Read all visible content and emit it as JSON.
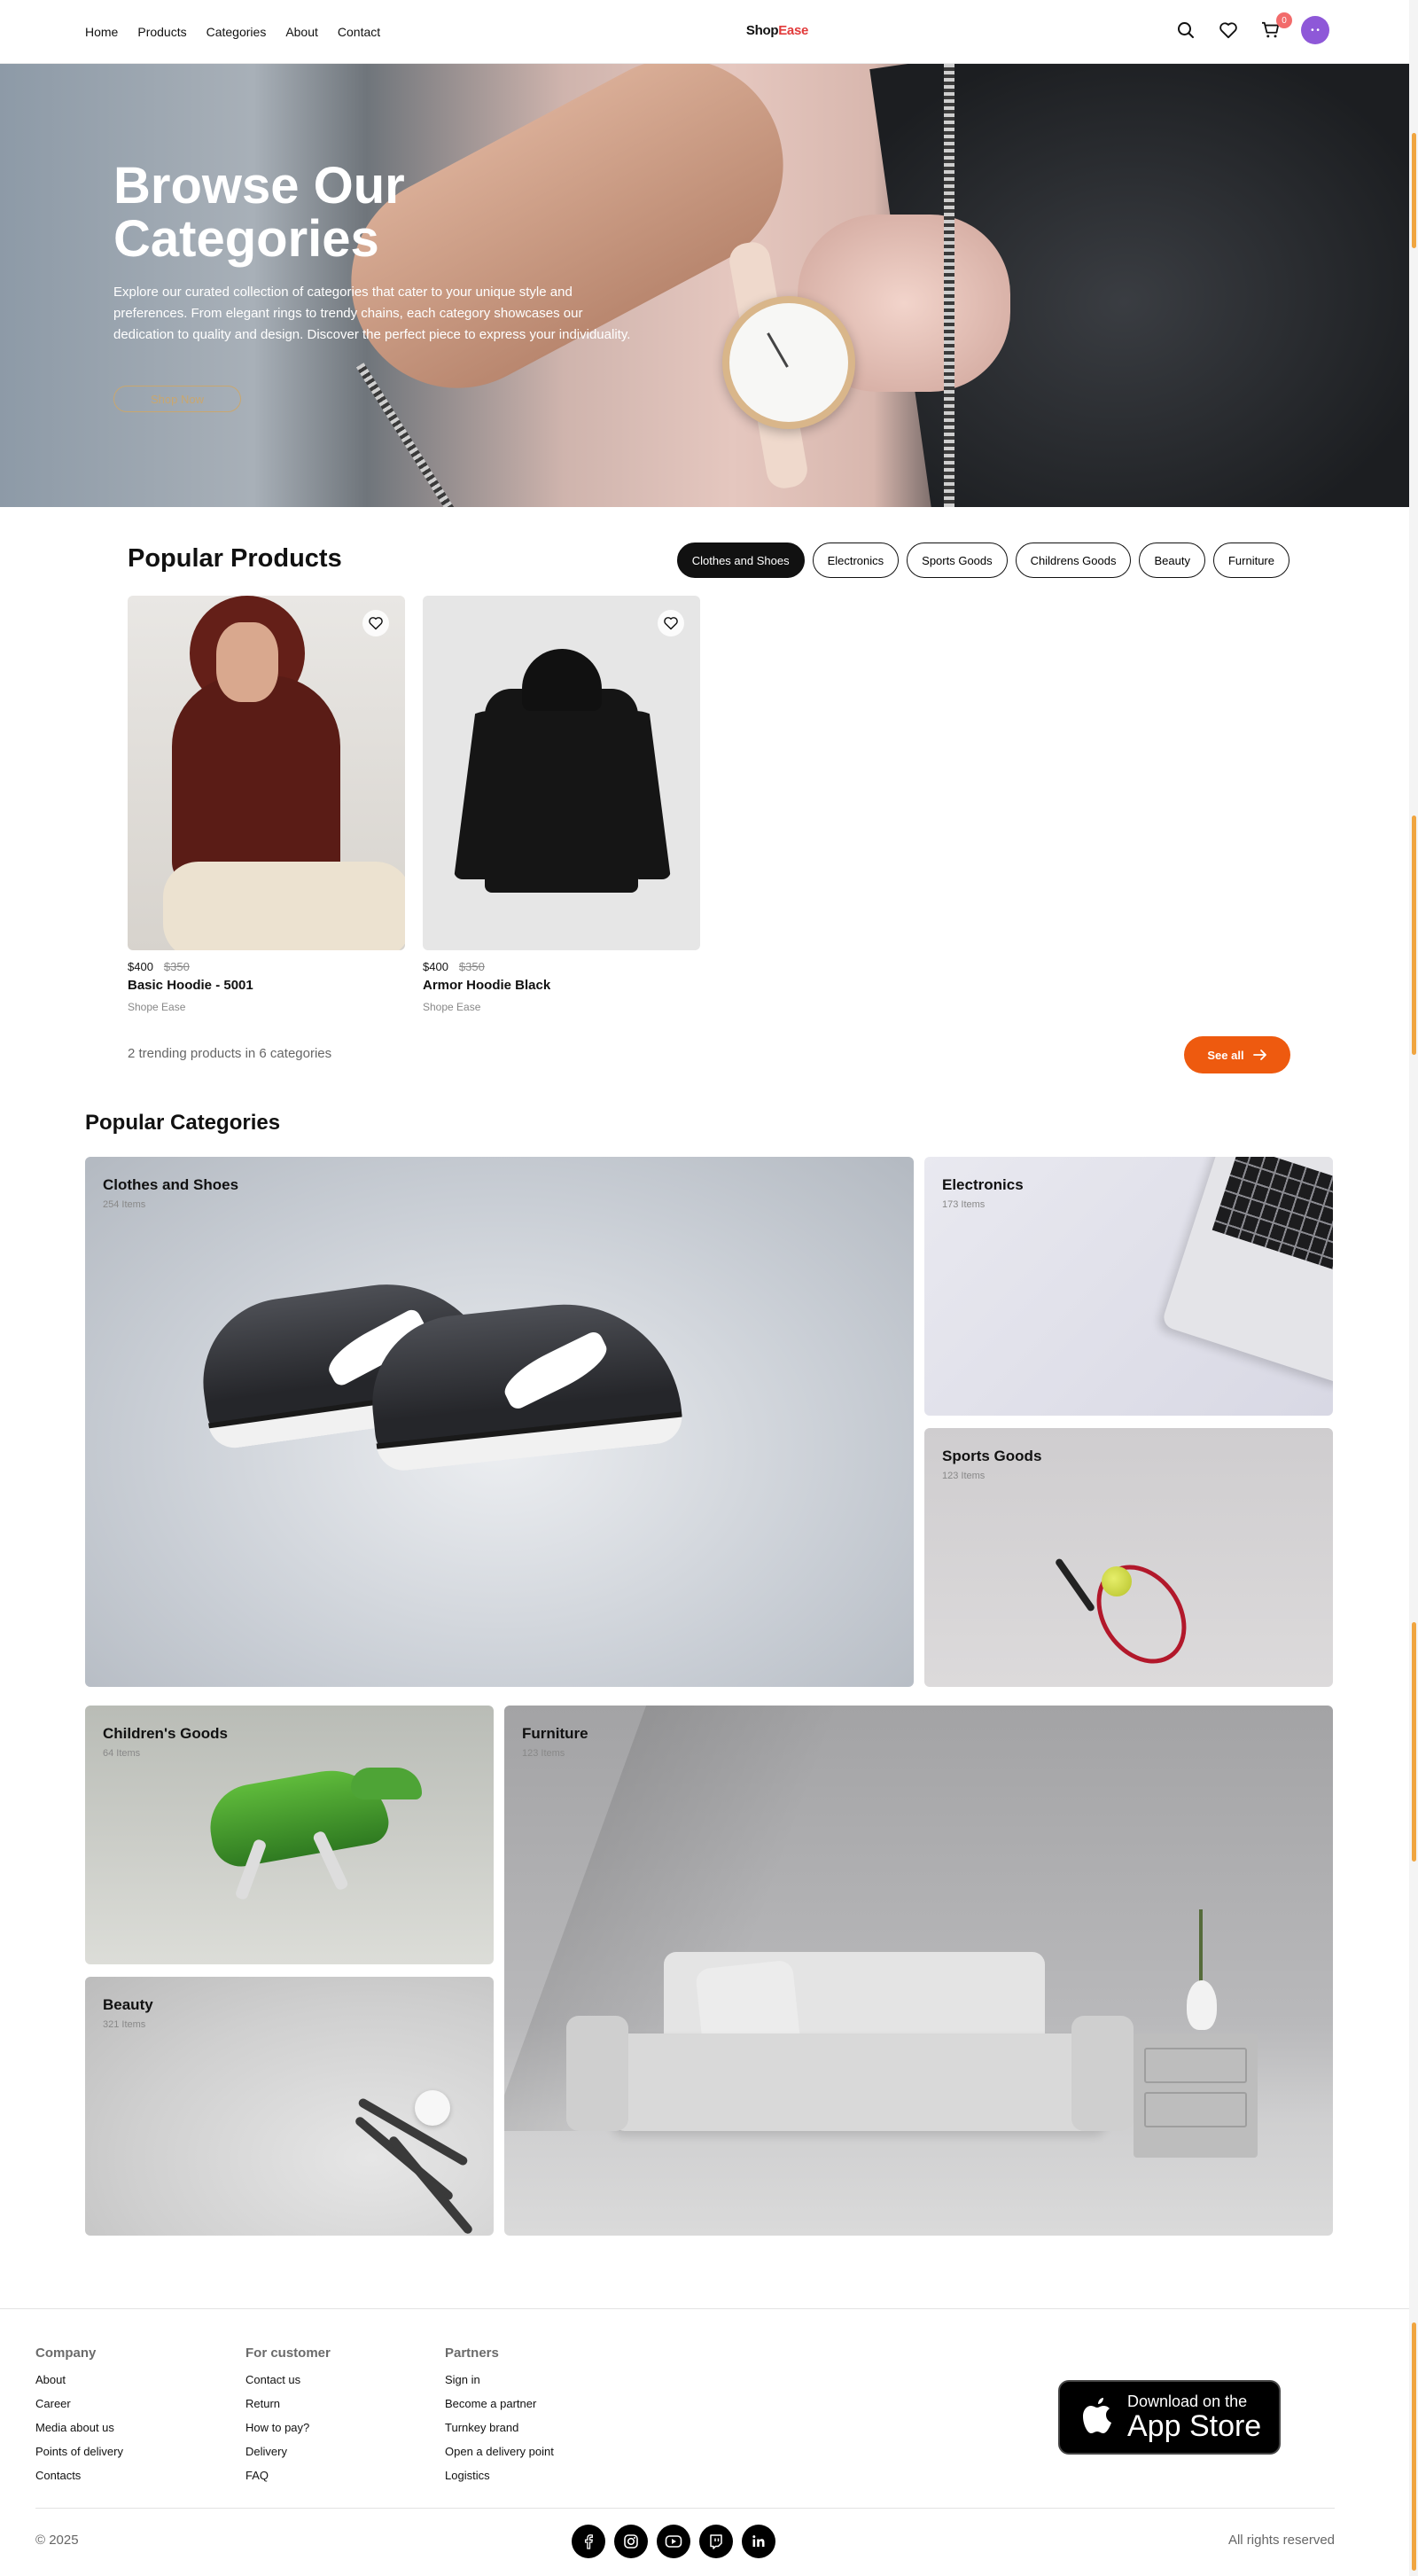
{
  "header": {
    "nav": [
      "Home",
      "Products",
      "Categories",
      "About",
      "Contact"
    ],
    "logo_part1": "Shop",
    "logo_part2": "Ease",
    "cart_count": "0",
    "avatar_text": "• •",
    "icons": [
      "search-icon",
      "heart-icon",
      "cart-icon",
      "avatar"
    ]
  },
  "hero": {
    "title": "Browse Our Categories",
    "description": "Explore our curated collection of categories that cater to your unique style and preferences. From elegant rings to trendy chains, each category showcases our dedication to quality and design. Discover the perfect piece to express your individuality.",
    "button": "Shop Now"
  },
  "popular_products": {
    "title": "Popular Products",
    "filters": [
      {
        "label": "Clothes and Shoes",
        "active": true
      },
      {
        "label": "Electronics",
        "active": false
      },
      {
        "label": "Sports Goods",
        "active": false
      },
      {
        "label": "Childrens Goods",
        "active": false
      },
      {
        "label": "Beauty",
        "active": false
      },
      {
        "label": "Furniture",
        "active": false
      }
    ],
    "products": [
      {
        "price": "$400",
        "old_price": "$350",
        "name": "Basic Hoodie - 5001",
        "brand": "Shope Ease"
      },
      {
        "price": "$400",
        "old_price": "$350",
        "name": "Armor Hoodie Black",
        "brand": "Shope Ease"
      }
    ],
    "summary": "2 trending products in 6 categories",
    "see_all": "See all"
  },
  "popular_categories": {
    "title": "Popular Categories",
    "items": [
      {
        "name": "Clothes and Shoes",
        "count": "254 Items"
      },
      {
        "name": "Electronics",
        "count": "173 Items"
      },
      {
        "name": "Sports Goods",
        "count": "123 Items"
      },
      {
        "name": "Children's Goods",
        "count": "64 Items"
      },
      {
        "name": "Furniture",
        "count": "123 Items"
      },
      {
        "name": "Beauty",
        "count": "321 Items"
      }
    ]
  },
  "footer": {
    "columns": [
      {
        "title": "Company",
        "links": [
          "About",
          "Career",
          "Media about us",
          "Points of delivery",
          "Contacts"
        ]
      },
      {
        "title": "For customer",
        "links": [
          "Contact us",
          "Return",
          "How to pay?",
          "Delivery",
          "FAQ"
        ]
      },
      {
        "title": "Partners",
        "links": [
          "Sign in",
          "Become a partner",
          "Turnkey brand",
          "Open a delivery point",
          "Logistics"
        ]
      }
    ],
    "app_store_line1": "Download on the",
    "app_store_line2": "App Store",
    "copyright": "© 2025",
    "rights": "All rights reserved",
    "socials": [
      "facebook-icon",
      "instagram-icon",
      "youtube-icon",
      "twitch-icon",
      "linkedin-icon"
    ]
  },
  "colors": {
    "accent": "#ee5a0f",
    "logo_accent": "#e23b3b",
    "dark": "#111111",
    "avatar": "#8e58d8"
  }
}
